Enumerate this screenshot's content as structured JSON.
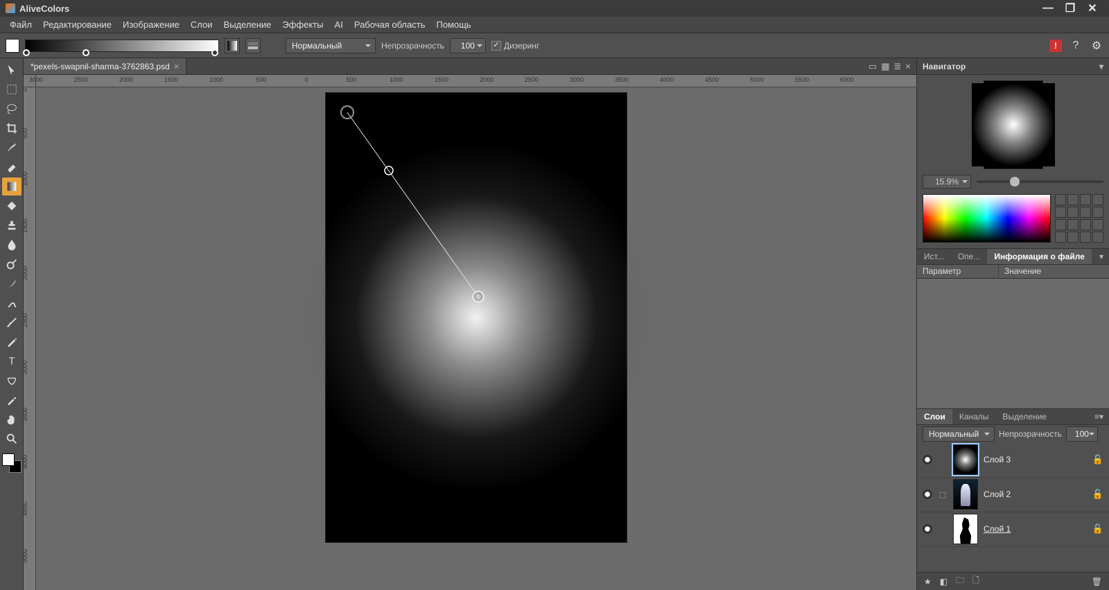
{
  "titlebar": {
    "title": "AliveColors"
  },
  "menu": {
    "file": "Файл",
    "edit": "Редактирование",
    "image": "Изображение",
    "layers": "Слои",
    "select": "Выделение",
    "effects": "Эффекты",
    "ai": "AI",
    "workspace": "Рабочая область",
    "help": "Помощь"
  },
  "options": {
    "blend_label": "Нормальный",
    "opacity_label": "Непрозрачность",
    "opacity_value": "100",
    "dither_label": "Дизеринг",
    "dither_checked": "✓"
  },
  "document": {
    "tab_title": "*pexels-swapnil-sharma-3762863.psd",
    "ruler_h": [
      "3000",
      "2500",
      "2000",
      "1500",
      "1000",
      "500",
      "0",
      "500",
      "1000",
      "1500",
      "2000",
      "2500",
      "3000",
      "3500",
      "4000",
      "4500",
      "5000",
      "5500",
      "6000"
    ],
    "ruler_v": [
      "0",
      "500",
      "1000",
      "1500",
      "2000",
      "2500",
      "3000",
      "3500",
      "4000",
      "4500",
      "5000"
    ]
  },
  "navigator": {
    "title": "Навигатор",
    "zoom": "15.9%"
  },
  "info_tabs": {
    "t1": "Ист...",
    "t2": "Опе...",
    "t3": "Информация о файле",
    "col_param": "Параметр",
    "col_value": "Значение"
  },
  "layers_tabs": {
    "layers": "Слои",
    "channels": "Каналы",
    "selection": "Выделение"
  },
  "layers_opts": {
    "blend": "Нормальный",
    "opacity_label": "Непрозрачность",
    "opacity_value": "100"
  },
  "layers": [
    {
      "name": "Слой 3",
      "active": true,
      "fx": false,
      "thumb": "glow",
      "underline": false
    },
    {
      "name": "Слой 2",
      "active": false,
      "fx": true,
      "thumb": "photo",
      "underline": false
    },
    {
      "name": "Слой 1",
      "active": false,
      "fx": false,
      "thumb": "sil",
      "underline": true
    }
  ]
}
